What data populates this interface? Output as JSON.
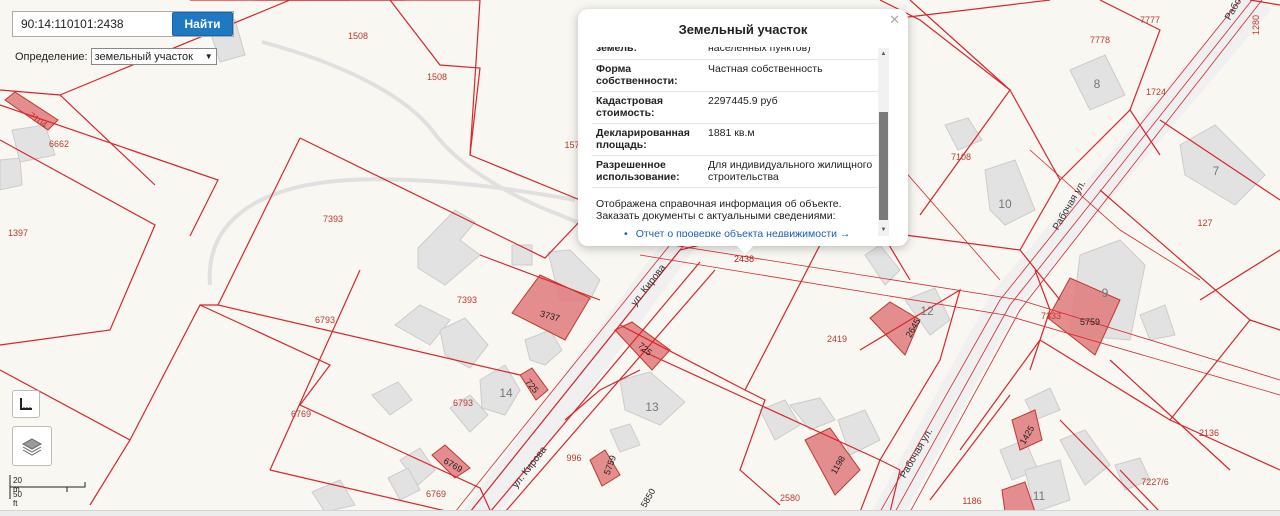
{
  "search": {
    "value": "90:14:110101:2438",
    "button_label": "Найти"
  },
  "definition": {
    "label": "Определение:",
    "selected": "земельный участок"
  },
  "popup": {
    "title": "Земельный участок",
    "partial_row": {
      "key": "земель:",
      "value": "населенных пунктов)"
    },
    "rows": [
      {
        "key": "Форма собственности:",
        "value": "Частная собственность"
      },
      {
        "key": "Кадастровая стоимость:",
        "value": "2297445.9 руб"
      },
      {
        "key": "Декларированная площадь:",
        "value": "1881 кв.м"
      },
      {
        "key": "Разрешенное использование:",
        "value": "Для индивидуального жилищного строительства"
      }
    ],
    "info_text": "Отображена справочная информация об объекте. Заказать документы с актуальными сведениями:",
    "link_text": "Отчет о проверке объекта недвижимости →"
  },
  "scale": {
    "metric": "20 m",
    "imperial": "50 ft"
  },
  "streets": [
    "ул. Кирова",
    "ул. Кирова",
    "Рабочая ул.",
    "Рабочая ул.",
    "Рабо"
  ],
  "parcel_labels": [
    "1508",
    "1508",
    "7104",
    "6662",
    "157",
    "1397",
    "7393",
    "7393",
    "6793",
    "6769",
    "6793",
    "3737",
    "725",
    "725",
    "2438",
    "996",
    "5850",
    "2580",
    "1198",
    "2419",
    "2645",
    "7108",
    "7778",
    "7777",
    "1724",
    "1280",
    "127",
    "7333",
    "5759",
    "2136",
    "7227/6",
    "1186",
    "1425"
  ],
  "house_numbers": [
    "8",
    "10",
    "7",
    "12",
    "13",
    "14",
    "11",
    "9"
  ],
  "icons": {
    "select": "chevron-down-icon",
    "close": "close-icon",
    "ruler": "ruler-icon",
    "layers": "layers-icon"
  },
  "colors": {
    "parcel_line": "#d9262c",
    "selected_parcel_fill": "#e07a7d",
    "building": "#e2e2e2",
    "button": "#1e78c2",
    "link": "#1a5fb4"
  }
}
